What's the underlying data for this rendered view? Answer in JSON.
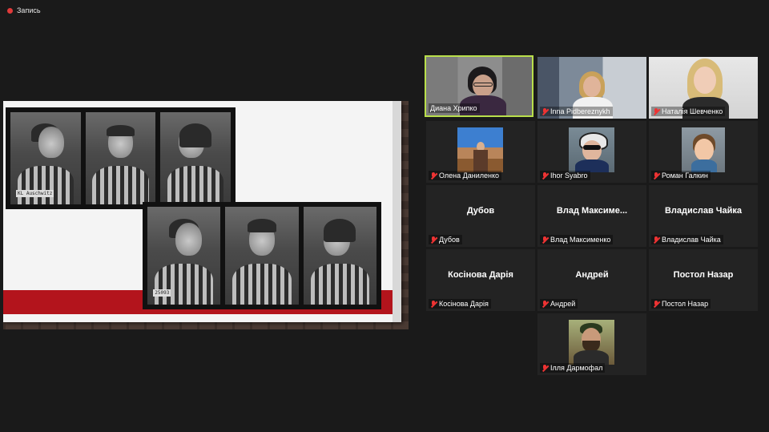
{
  "recording": {
    "label": "Запись"
  },
  "share": {
    "mugshot_tags": [
      "KL Auschwitz",
      "",
      "",
      "25093",
      "",
      ""
    ]
  },
  "participants": [
    {
      "name": "Диана Хрипко",
      "display": "",
      "video": true,
      "muted": false,
      "active": true
    },
    {
      "name": "Inna Pidbereznykh",
      "display": "",
      "video": true,
      "muted": true
    },
    {
      "name": "Наталія Шевченко",
      "display": "",
      "video": true,
      "muted": true
    },
    {
      "name": "Олена Даниленко",
      "display": "",
      "video": true,
      "muted": true
    },
    {
      "name": "Ihor Syabro",
      "display": "",
      "video": true,
      "muted": true
    },
    {
      "name": "Роман Галкин",
      "display": "",
      "video": true,
      "muted": true
    },
    {
      "name": "Дубов",
      "display": "Дубов",
      "video": false,
      "muted": true
    },
    {
      "name": "Влад Максименко",
      "display": "Влад Максиме...",
      "video": false,
      "muted": true
    },
    {
      "name": "Владислав Чайка",
      "display": "Владислав Чайка",
      "video": false,
      "muted": true
    },
    {
      "name": "Косінова Дарія",
      "display": "Косінова Дарія",
      "video": false,
      "muted": true
    },
    {
      "name": "Андрей",
      "display": "Андрей",
      "video": false,
      "muted": true
    },
    {
      "name": "Постол Назар",
      "display": "Постол Назар",
      "video": false,
      "muted": true
    },
    {
      "name": "Ілля Дармофал",
      "display": "",
      "video": true,
      "muted": true
    }
  ],
  "colors": {
    "active_border": "#b9df4b",
    "muted": "#e33333",
    "tile_bg": "#232323",
    "slide_red": "#b3141c"
  }
}
